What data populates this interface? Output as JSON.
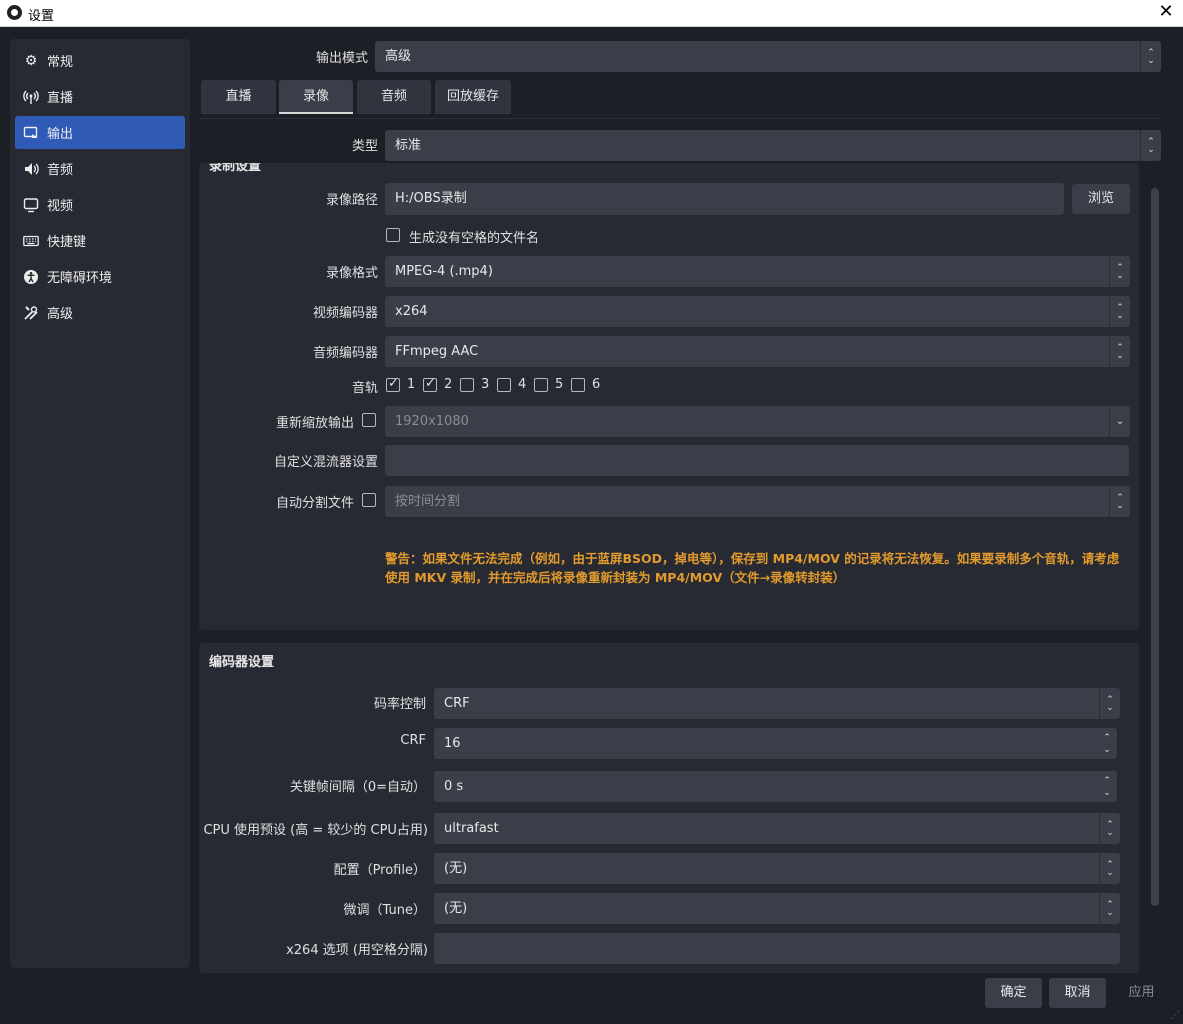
{
  "window": {
    "title": "设置"
  },
  "sidebar": {
    "items": [
      {
        "label": "常规",
        "icon": "gear-icon"
      },
      {
        "label": "直播",
        "icon": "antenna-icon"
      },
      {
        "label": "输出",
        "icon": "output-icon"
      },
      {
        "label": "音频",
        "icon": "speaker-icon"
      },
      {
        "label": "视频",
        "icon": "monitor-icon"
      },
      {
        "label": "快捷键",
        "icon": "keyboard-icon"
      },
      {
        "label": "无障碍环境",
        "icon": "accessibility-icon"
      },
      {
        "label": "高级",
        "icon": "tools-icon"
      }
    ],
    "active": "输出"
  },
  "output_mode": {
    "label": "输出模式",
    "value": "高级"
  },
  "tabs": [
    "直播",
    "录像",
    "音频",
    "回放缓存"
  ],
  "active_tab": "录像",
  "type": {
    "label": "类型",
    "value": "标准"
  },
  "recording": {
    "section_title_partial": "录制设置",
    "path_label": "录像路径",
    "path_value": "H:/OBS录制",
    "browse_label": "浏览",
    "no_space_label": "生成没有空格的文件名",
    "format_label": "录像格式",
    "format_value": "MPEG-4 (.mp4)",
    "video_encoder_label": "视频编码器",
    "video_encoder_value": "x264",
    "audio_encoder_label": "音频编码器",
    "audio_encoder_value": "FFmpeg AAC",
    "tracks_label": "音轨",
    "tracks": [
      {
        "n": "1",
        "checked": true
      },
      {
        "n": "2",
        "checked": true
      },
      {
        "n": "3",
        "checked": false
      },
      {
        "n": "4",
        "checked": false
      },
      {
        "n": "5",
        "checked": false
      },
      {
        "n": "6",
        "checked": false
      }
    ],
    "rescale_label": "重新缩放输出",
    "rescale_value": "1920x1080",
    "muxer_label": "自定义混流器设置",
    "muxer_value": "",
    "split_label": "自动分割文件",
    "split_value": "按时间分割",
    "warning": "警告：如果文件无法完成（例如，由于蓝屏BSOD，掉电等），保存到 MP4/MOV 的记录将无法恢复。如果要录制多个音轨，请考虑使用 MKV 录制，并在完成后将录像重新封装为 MP4/MOV（文件→录像转封装）"
  },
  "encoder": {
    "title": "编码器设置",
    "rate_control_label": "码率控制",
    "rate_control_value": "CRF",
    "crf_label": "CRF",
    "crf_value": "16",
    "keyframe_label": "关键帧间隔（0=自动）",
    "keyframe_value": "0 s",
    "preset_label": "CPU 使用预设 (高 = 较少的 CPU占用)",
    "preset_value": "ultrafast",
    "profile_label": "配置（Profile）",
    "profile_value": "(无)",
    "tune_label": "微调（Tune）",
    "tune_value": "(无)",
    "x264opts_label": "x264 选项 (用空格分隔)",
    "x264opts_value": ""
  },
  "footer": {
    "ok": "确定",
    "cancel": "取消",
    "apply": "应用"
  }
}
